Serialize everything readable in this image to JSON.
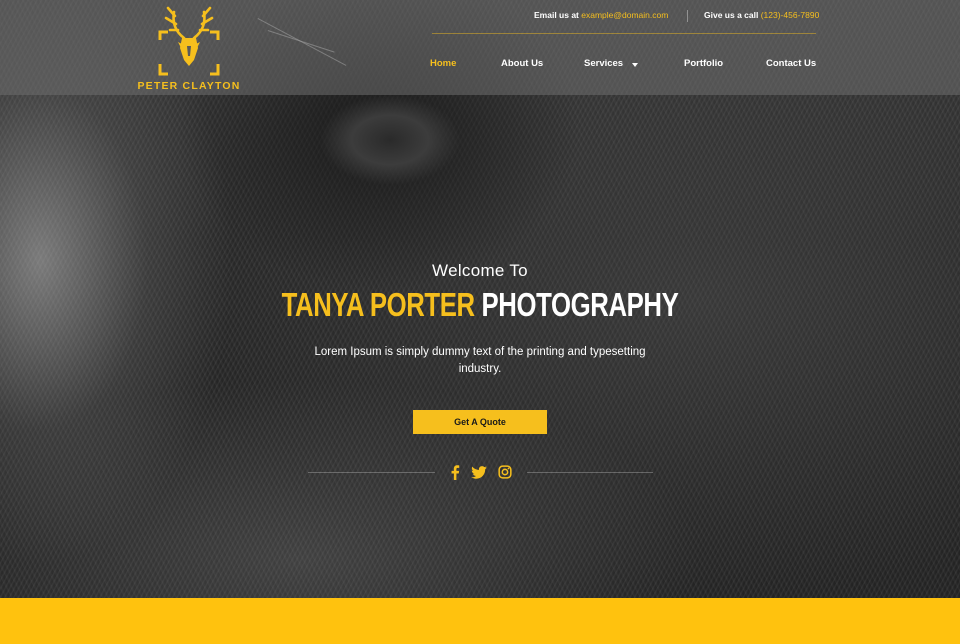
{
  "brand": {
    "name": "PETER CLAYTON",
    "accent_color": "#f6bf1d",
    "logo_icon": "deer-head-icon"
  },
  "topbar": {
    "email_label": "Email us at",
    "email": "example@domain.com",
    "phone_label": "Give us a call",
    "phone": "(123)-456-7890"
  },
  "nav": {
    "items": [
      {
        "label": "Home",
        "active": true
      },
      {
        "label": "About Us",
        "active": false
      },
      {
        "label": "Services",
        "active": false,
        "dropdown": true
      },
      {
        "label": "Portfolio",
        "active": false
      },
      {
        "label": "Contact Us",
        "active": false
      }
    ]
  },
  "hero": {
    "welcome": "Welcome To",
    "headline_highlight": "TANYA PORTER",
    "headline_rest": "PHOTOGRAPHY",
    "subtitle": "Lorem Ipsum is simply dummy text of the printing and typesetting industry.",
    "cta_label": "Get A Quote"
  },
  "social": {
    "icons": [
      "facebook-icon",
      "twitter-icon",
      "instagram-icon"
    ]
  },
  "colors": {
    "footer_band": "#ffc20e",
    "header_overlay": "#6e6e6e"
  }
}
